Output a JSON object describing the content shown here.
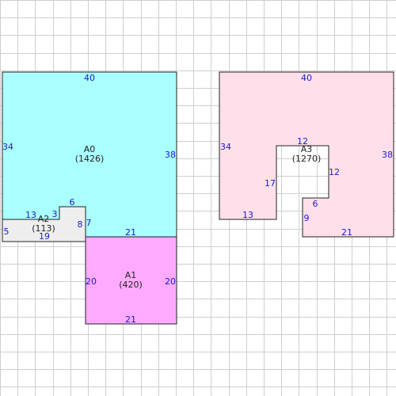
{
  "colors": {
    "background": "#ffffff",
    "grid": "#cfcfcf",
    "outline": "#222222",
    "edge_label": "#1a1acc",
    "area_label": "#222222"
  },
  "shapes": [
    {
      "id": "A0",
      "label": "A0",
      "area": "(1426)",
      "fill": "#aaffff",
      "edges": [
        "40",
        "38",
        "21",
        "7",
        "6",
        "3",
        "13",
        "34"
      ]
    },
    {
      "id": "A1",
      "label": "A1",
      "area": "(420)",
      "fill": "#ffaaff",
      "edges": [
        "20",
        "20",
        "21"
      ]
    },
    {
      "id": "A2",
      "label": "A2",
      "area": "(113)",
      "fill": "#eeeeee",
      "edges": [
        "5",
        "19",
        "8"
      ]
    },
    {
      "id": "A3",
      "label": "A3",
      "area": "(1270)",
      "fill": "#ffe0ea",
      "edges": [
        "40",
        "34",
        "38",
        "13",
        "17",
        "12",
        "12",
        "6",
        "9",
        "21"
      ]
    }
  ]
}
